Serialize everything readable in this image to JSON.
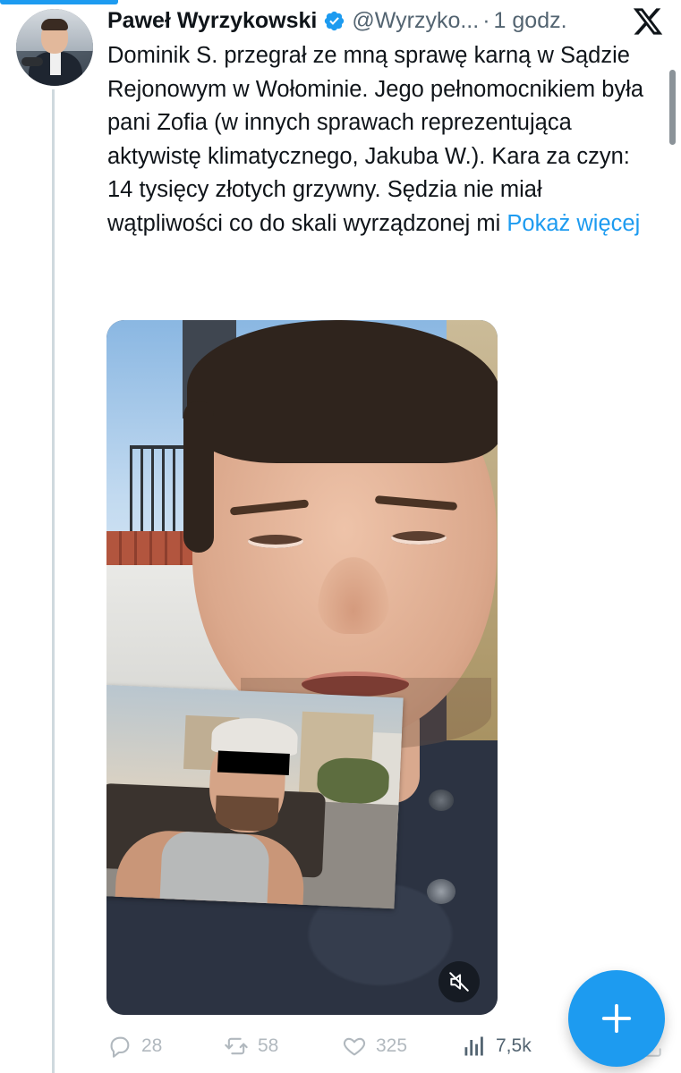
{
  "tweet": {
    "author_name": "Paweł Wyrzykowski",
    "handle": "@Wyrzyko...",
    "separator": "·",
    "timestamp": "1 godz.",
    "text": "Dominik S. przegrał ze mną sprawę karną w Sądzie Rejonowym w Wołominie. Jego pełnomocnikiem była pani Zofia (w innych sprawach reprezentująca aktywistę klimatycznego, Jakuba W.). Kara za czyn: 14 tysięcy złotych grzywny. Sędzia nie miał wątpliwości co do skali wyrządzonej mi",
    "show_more": "Pokaż więcej"
  },
  "actions": {
    "replies": "28",
    "reposts": "58",
    "likes": "325",
    "views": "7,5k"
  },
  "icons": {
    "verified": "verified-badge-icon",
    "logo": "x-logo-icon",
    "mute": "speaker-muted-icon",
    "reply": "reply-bubble-icon",
    "repost": "repost-arrows-icon",
    "like": "heart-icon",
    "views": "bar-chart-icon",
    "share": "share-icon",
    "compose": "plus-icon"
  },
  "colors": {
    "accent": "#1d9bf0",
    "text": "#0f1419",
    "secondary": "#536471",
    "thread_line": "#cfd9de"
  }
}
